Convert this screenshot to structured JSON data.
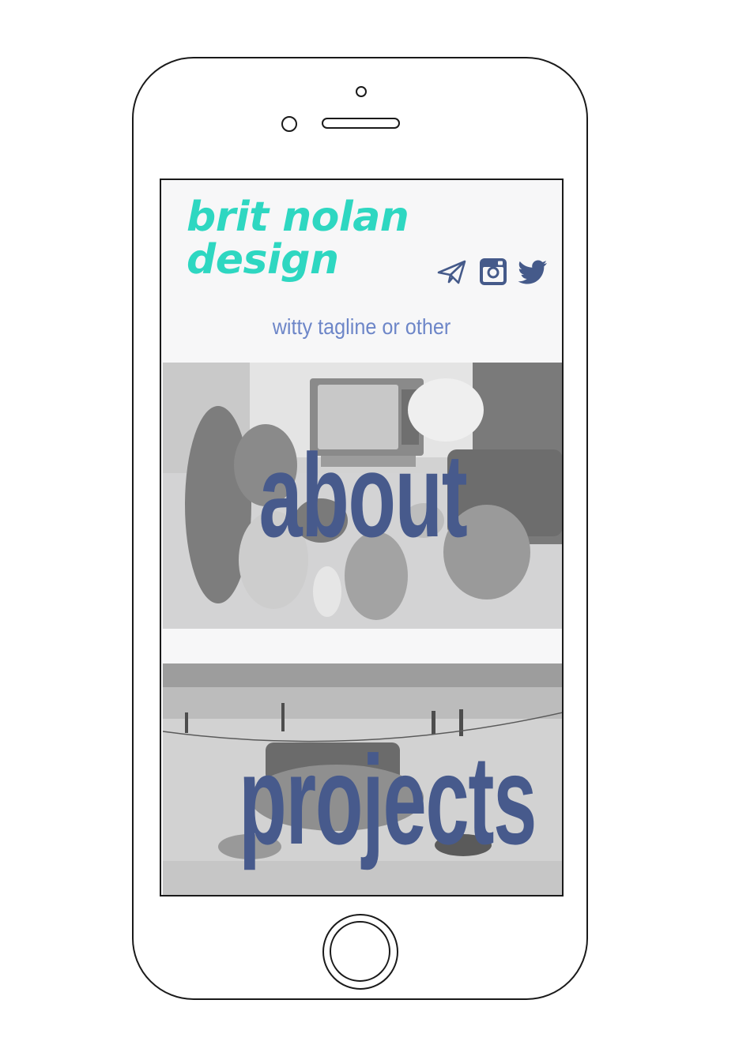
{
  "brand": {
    "line1": "brit nolan",
    "line2": "design",
    "color": "#2ed7c1"
  },
  "header": {
    "tagline": "witty tagline or other",
    "social_icons": [
      "send-icon",
      "instagram-icon",
      "twitter-icon"
    ],
    "icon_color": "#455a8a"
  },
  "sections": {
    "about": {
      "title": "about"
    },
    "projects": {
      "title": "projects"
    }
  },
  "colors": {
    "title_color": "#475a8c",
    "tagline_color": "#6d86c8",
    "screen_bg": "#f7f7f8"
  }
}
